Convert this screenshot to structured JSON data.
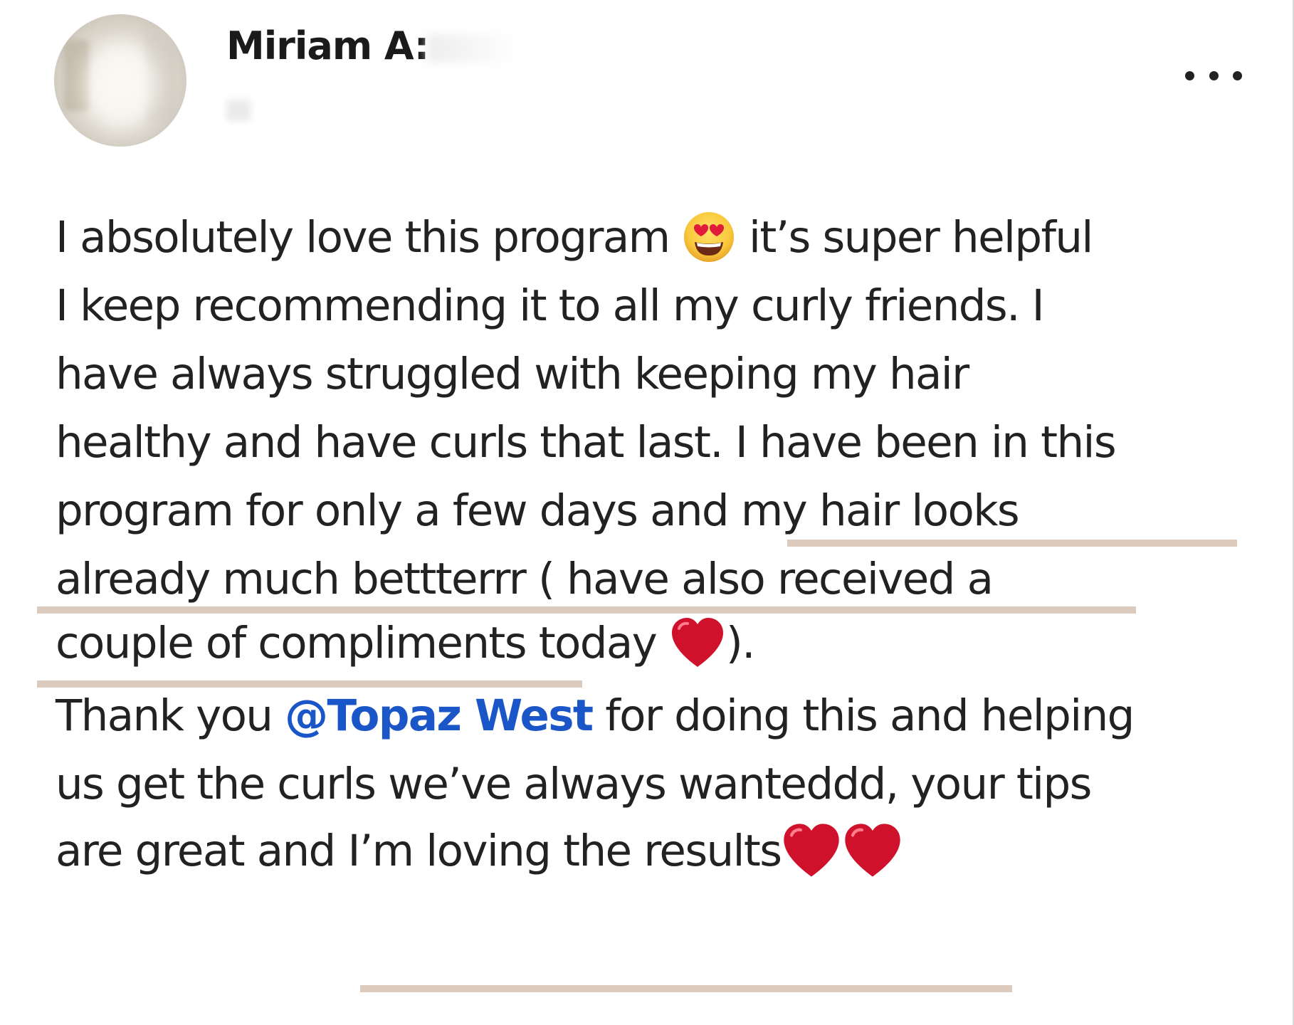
{
  "post": {
    "author_name": "Miriam A:",
    "avatar_icon": "profile-photo-blurred",
    "more_icon": "more-horizontal-icon",
    "lines": {
      "l1a": "I absolutely love this program",
      "l1b": "it’s super helpful",
      "l2": "I keep recommending it to all my curly friends. I",
      "l3": "have always struggled with keeping my hair",
      "l4": "healthy and have curls that last. I have been in this",
      "l5": "program for only a few days and my hair looks",
      "l6": "already much bettterrr ( have also received a",
      "l7a": "couple of compliments today",
      "l7b": ").",
      "l8a": "Thank you ",
      "l8_mention": "@Topaz West",
      "l8b": " for doing this and helping",
      "l9": "us get the curls we’ve always wanteddd, your tips",
      "l10": "are great and I’m loving the results"
    },
    "emojis": {
      "heart_eyes": "smiling-face-with-heart-eyes-icon",
      "heart": "red-heart-icon"
    }
  },
  "colors": {
    "text": "#222222",
    "mention": "#1a56c7",
    "highlight_underline": "#dccbbd",
    "heart": "#d0112b",
    "emoji_face": "#f9c93c"
  }
}
